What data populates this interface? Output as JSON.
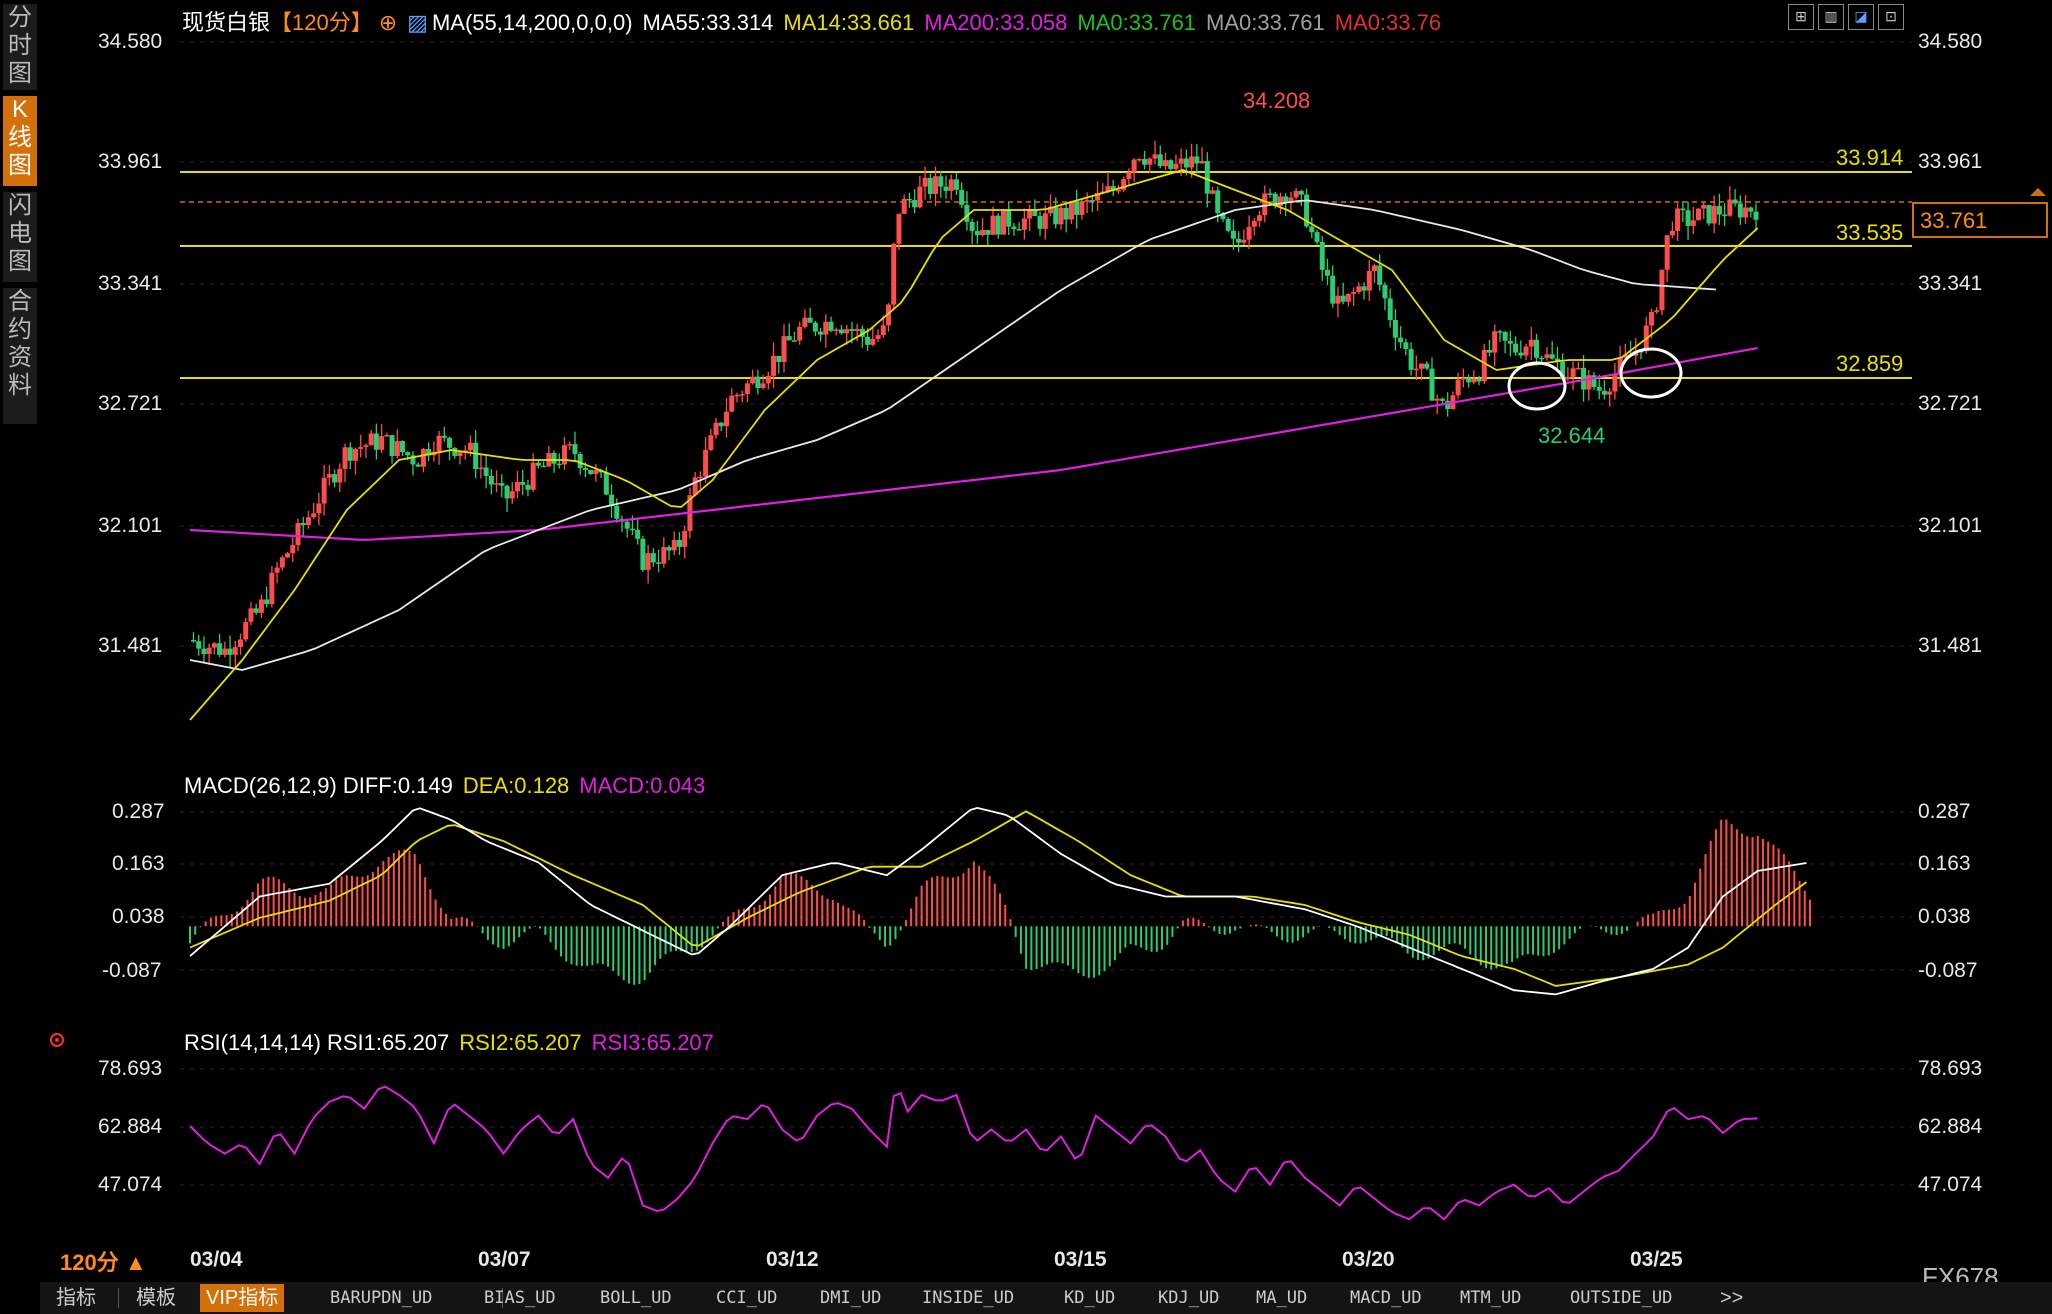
{
  "sidebar": {
    "tabs": [
      {
        "label": "分时图",
        "active": false
      },
      {
        "label": "K线图",
        "active": true
      },
      {
        "label": "闪电图",
        "active": false
      },
      {
        "label": "合约资料",
        "active": false
      }
    ]
  },
  "header": {
    "symbol": "现货白银",
    "period": "【120分】",
    "ma_label": "MA(55,14,200,0,0,0)",
    "ma_values": [
      {
        "text": "MA55:33.314",
        "color": "#ffffff"
      },
      {
        "text": "MA14:33.661",
        "color": "#e8e000"
      },
      {
        "text": "MA200:33.058",
        "color": "#e020e0"
      },
      {
        "text": "MA0:33.761",
        "color": "#20c020"
      },
      {
        "text": "MA0:33.761",
        "color": "#a0a0a0"
      },
      {
        "text": "MA0:33.76",
        "color": "#e03030"
      }
    ],
    "toolbar_icons": [
      "grid-icon",
      "columns-icon",
      "chart-icon",
      "fullscreen-icon"
    ]
  },
  "colors": {
    "up": "#ff4d4d",
    "down": "#2ecc71",
    "ma55": "#e8e8e8",
    "ma14": "#e8e000",
    "ma200": "#e020e0",
    "level": "#e8e000",
    "accent": "#d4700a"
  },
  "price_axis": {
    "ticks": [
      "34.580",
      "33.961",
      "33.341",
      "32.721",
      "32.101",
      "31.481"
    ],
    "current_price": "33.761"
  },
  "annotations": {
    "high": "34.208",
    "low": "32.644",
    "levels": [
      "33.914",
      "33.535",
      "32.859"
    ]
  },
  "macd": {
    "title": "MACD(26,12,9)",
    "diff": "DIFF:0.149",
    "dea": "DEA:0.128",
    "macd": "MACD:0.043",
    "ticks": [
      "0.287",
      "0.163",
      "0.038",
      "-0.087"
    ]
  },
  "rsi": {
    "title": "RSI(14,14,14)",
    "rsi1": "RSI1:65.207",
    "rsi2": "RSI2:65.207",
    "rsi3": "RSI3:65.207",
    "ticks": [
      "78.693",
      "62.884",
      "47.074"
    ]
  },
  "x_axis": {
    "period_label": "120分 ▲",
    "dates": [
      "03/04",
      "03/07",
      "03/12",
      "03/15",
      "03/20",
      "03/25"
    ]
  },
  "bottom_tabs": [
    "指标",
    "模板",
    "VIP指标",
    "BARUPDN_UD",
    "BIAS_UD",
    "BOLL_UD",
    "CCI_UD",
    "DMI_UD",
    "INSIDE_UD",
    "KD_UD",
    "KDJ_UD",
    "MA_UD",
    "MACD_UD",
    "MTM_UD",
    "OUTSIDE_UD",
    ">>"
  ],
  "watermark": "FX678",
  "chart_data": {
    "type": "candlestick",
    "x_range": [
      "03/04",
      "03/27"
    ],
    "y_range": [
      31.3,
      34.6
    ],
    "highlighted_levels": [
      33.914,
      33.535,
      32.859
    ],
    "last_price": 33.761,
    "high": 34.208,
    "low": 32.644,
    "close_path": [
      [
        0,
        31.6
      ],
      [
        10,
        31.55
      ],
      [
        20,
        31.75
      ],
      [
        25,
        31.95
      ],
      [
        35,
        32.25
      ],
      [
        45,
        32.55
      ],
      [
        55,
        32.6
      ],
      [
        65,
        32.5
      ],
      [
        70,
        32.6
      ],
      [
        80,
        32.55
      ],
      [
        90,
        32.3
      ],
      [
        100,
        32.45
      ],
      [
        110,
        32.55
      ],
      [
        120,
        32.35
      ],
      [
        130,
        32.0
      ],
      [
        140,
        32.05
      ],
      [
        145,
        32.4
      ],
      [
        155,
        32.8
      ],
      [
        165,
        32.95
      ],
      [
        175,
        33.15
      ],
      [
        185,
        33.2
      ],
      [
        195,
        33.1
      ],
      [
        200,
        33.15
      ],
      [
        203,
        33.75
      ],
      [
        210,
        33.85
      ],
      [
        220,
        33.9
      ],
      [
        225,
        33.65
      ],
      [
        235,
        33.7
      ],
      [
        245,
        33.7
      ],
      [
        255,
        33.75
      ],
      [
        265,
        33.85
      ],
      [
        272,
        34.05
      ],
      [
        280,
        33.95
      ],
      [
        290,
        34.0
      ],
      [
        295,
        33.7
      ],
      [
        300,
        33.55
      ],
      [
        305,
        33.75
      ],
      [
        315,
        33.85
      ],
      [
        320,
        33.75
      ],
      [
        325,
        33.45
      ],
      [
        330,
        33.25
      ],
      [
        340,
        33.45
      ],
      [
        345,
        33.2
      ],
      [
        350,
        33.0
      ],
      [
        355,
        32.9
      ],
      [
        360,
        32.75
      ],
      [
        365,
        32.9
      ],
      [
        370,
        32.95
      ],
      [
        375,
        33.1
      ],
      [
        380,
        33.05
      ],
      [
        385,
        33.1
      ],
      [
        390,
        33.0
      ],
      [
        395,
        32.95
      ],
      [
        400,
        32.9
      ],
      [
        405,
        32.85
      ],
      [
        410,
        32.95
      ],
      [
        415,
        33.05
      ],
      [
        420,
        33.2
      ],
      [
        425,
        33.7
      ],
      [
        430,
        33.7
      ],
      [
        440,
        33.75
      ],
      [
        450,
        33.76
      ]
    ],
    "ma55_path": [
      [
        0,
        31.5
      ],
      [
        15,
        31.45
      ],
      [
        35,
        31.55
      ],
      [
        60,
        31.75
      ],
      [
        85,
        32.05
      ],
      [
        115,
        32.25
      ],
      [
        140,
        32.35
      ],
      [
        160,
        32.5
      ],
      [
        180,
        32.6
      ],
      [
        200,
        32.75
      ],
      [
        225,
        33.05
      ],
      [
        250,
        33.35
      ],
      [
        275,
        33.6
      ],
      [
        300,
        33.75
      ],
      [
        320,
        33.8
      ],
      [
        340,
        33.75
      ],
      [
        365,
        33.65
      ],
      [
        385,
        33.55
      ],
      [
        400,
        33.45
      ],
      [
        415,
        33.38
      ],
      [
        440,
        33.35
      ]
    ],
    "ma14_path": [
      [
        0,
        31.2
      ],
      [
        15,
        31.5
      ],
      [
        30,
        31.85
      ],
      [
        45,
        32.25
      ],
      [
        60,
        32.5
      ],
      [
        75,
        32.55
      ],
      [
        95,
        32.5
      ],
      [
        110,
        32.5
      ],
      [
        125,
        32.4
      ],
      [
        140,
        32.25
      ],
      [
        150,
        32.4
      ],
      [
        165,
        32.75
      ],
      [
        180,
        33.0
      ],
      [
        195,
        33.15
      ],
      [
        205,
        33.3
      ],
      [
        215,
        33.6
      ],
      [
        225,
        33.75
      ],
      [
        245,
        33.75
      ],
      [
        265,
        33.85
      ],
      [
        285,
        33.95
      ],
      [
        300,
        33.85
      ],
      [
        315,
        33.75
      ],
      [
        330,
        33.6
      ],
      [
        345,
        33.45
      ],
      [
        360,
        33.1
      ],
      [
        375,
        32.95
      ],
      [
        395,
        33.0
      ],
      [
        410,
        33.0
      ],
      [
        425,
        33.2
      ],
      [
        440,
        33.5
      ],
      [
        450,
        33.66
      ]
    ],
    "ma200_path": [
      [
        0,
        32.15
      ],
      [
        50,
        32.1
      ],
      [
        100,
        32.15
      ],
      [
        150,
        32.25
      ],
      [
        200,
        32.35
      ],
      [
        250,
        32.45
      ],
      [
        300,
        32.6
      ],
      [
        350,
        32.75
      ],
      [
        400,
        32.9
      ],
      [
        450,
        33.06
      ]
    ],
    "macd_range": [
      -0.22,
      0.32
    ],
    "diff_path": [
      [
        0,
        -0.07
      ],
      [
        20,
        0.07
      ],
      [
        40,
        0.1
      ],
      [
        55,
        0.2
      ],
      [
        65,
        0.28
      ],
      [
        75,
        0.25
      ],
      [
        85,
        0.2
      ],
      [
        100,
        0.15
      ],
      [
        115,
        0.05
      ],
      [
        125,
        0.01
      ],
      [
        135,
        -0.03
      ],
      [
        145,
        -0.07
      ],
      [
        155,
        0.0
      ],
      [
        170,
        0.12
      ],
      [
        185,
        0.15
      ],
      [
        200,
        0.12
      ],
      [
        210,
        0.18
      ],
      [
        225,
        0.28
      ],
      [
        235,
        0.26
      ],
      [
        250,
        0.17
      ],
      [
        265,
        0.1
      ],
      [
        280,
        0.07
      ],
      [
        300,
        0.07
      ],
      [
        320,
        0.04
      ],
      [
        335,
        0.0
      ],
      [
        350,
        -0.05
      ],
      [
        365,
        -0.1
      ],
      [
        380,
        -0.15
      ],
      [
        392,
        -0.16
      ],
      [
        405,
        -0.13
      ],
      [
        420,
        -0.1
      ],
      [
        430,
        -0.05
      ],
      [
        440,
        0.07
      ],
      [
        450,
        0.13
      ],
      [
        465,
        0.15
      ]
    ],
    "dea_path": [
      [
        0,
        -0.05
      ],
      [
        20,
        0.02
      ],
      [
        40,
        0.06
      ],
      [
        55,
        0.12
      ],
      [
        65,
        0.2
      ],
      [
        75,
        0.24
      ],
      [
        90,
        0.2
      ],
      [
        110,
        0.12
      ],
      [
        130,
        0.05
      ],
      [
        145,
        -0.05
      ],
      [
        160,
        0.02
      ],
      [
        175,
        0.08
      ],
      [
        195,
        0.14
      ],
      [
        210,
        0.14
      ],
      [
        225,
        0.2
      ],
      [
        240,
        0.27
      ],
      [
        255,
        0.2
      ],
      [
        270,
        0.12
      ],
      [
        285,
        0.07
      ],
      [
        305,
        0.07
      ],
      [
        320,
        0.05
      ],
      [
        335,
        0.01
      ],
      [
        350,
        -0.02
      ],
      [
        365,
        -0.07
      ],
      [
        380,
        -0.1
      ],
      [
        392,
        -0.14
      ],
      [
        410,
        -0.12
      ],
      [
        430,
        -0.09
      ],
      [
        440,
        -0.05
      ],
      [
        455,
        0.05
      ],
      [
        465,
        0.11
      ]
    ],
    "rsi_range": [
      30,
      85
    ],
    "rsi_path": [
      [
        0,
        63
      ],
      [
        5,
        58
      ],
      [
        10,
        55
      ],
      [
        15,
        58
      ],
      [
        20,
        52
      ],
      [
        25,
        62
      ],
      [
        30,
        55
      ],
      [
        35,
        65
      ],
      [
        40,
        70
      ],
      [
        45,
        72
      ],
      [
        50,
        68
      ],
      [
        55,
        75
      ],
      [
        60,
        72
      ],
      [
        65,
        68
      ],
      [
        70,
        58
      ],
      [
        75,
        70
      ],
      [
        80,
        66
      ],
      [
        85,
        62
      ],
      [
        90,
        55
      ],
      [
        95,
        62
      ],
      [
        100,
        66
      ],
      [
        105,
        60
      ],
      [
        110,
        65
      ],
      [
        115,
        52
      ],
      [
        120,
        48
      ],
      [
        125,
        55
      ],
      [
        130,
        40
      ],
      [
        135,
        38
      ],
      [
        140,
        42
      ],
      [
        145,
        48
      ],
      [
        150,
        58
      ],
      [
        155,
        66
      ],
      [
        160,
        65
      ],
      [
        165,
        70
      ],
      [
        170,
        62
      ],
      [
        175,
        58
      ],
      [
        180,
        66
      ],
      [
        185,
        70
      ],
      [
        190,
        68
      ],
      [
        195,
        62
      ],
      [
        200,
        57
      ],
      [
        203,
        79
      ],
      [
        205,
        66
      ],
      [
        210,
        72
      ],
      [
        215,
        70
      ],
      [
        220,
        72
      ],
      [
        225,
        58
      ],
      [
        230,
        62
      ],
      [
        235,
        58
      ],
      [
        240,
        62
      ],
      [
        245,
        55
      ],
      [
        250,
        60
      ],
      [
        255,
        52
      ],
      [
        260,
        66
      ],
      [
        265,
        62
      ],
      [
        270,
        58
      ],
      [
        275,
        64
      ],
      [
        280,
        60
      ],
      [
        285,
        52
      ],
      [
        290,
        56
      ],
      [
        295,
        48
      ],
      [
        300,
        44
      ],
      [
        305,
        52
      ],
      [
        310,
        46
      ],
      [
        315,
        54
      ],
      [
        320,
        48
      ],
      [
        325,
        44
      ],
      [
        330,
        40
      ],
      [
        335,
        46
      ],
      [
        340,
        42
      ],
      [
        345,
        38
      ],
      [
        350,
        36
      ],
      [
        355,
        40
      ],
      [
        360,
        36
      ],
      [
        365,
        42
      ],
      [
        370,
        40
      ],
      [
        375,
        44
      ],
      [
        380,
        46
      ],
      [
        385,
        42
      ],
      [
        390,
        45
      ],
      [
        395,
        40
      ],
      [
        400,
        44
      ],
      [
        405,
        48
      ],
      [
        410,
        50
      ],
      [
        415,
        55
      ],
      [
        420,
        60
      ],
      [
        425,
        69
      ],
      [
        430,
        65
      ],
      [
        435,
        66
      ],
      [
        440,
        61
      ],
      [
        445,
        65
      ],
      [
        450,
        65.2
      ]
    ]
  }
}
